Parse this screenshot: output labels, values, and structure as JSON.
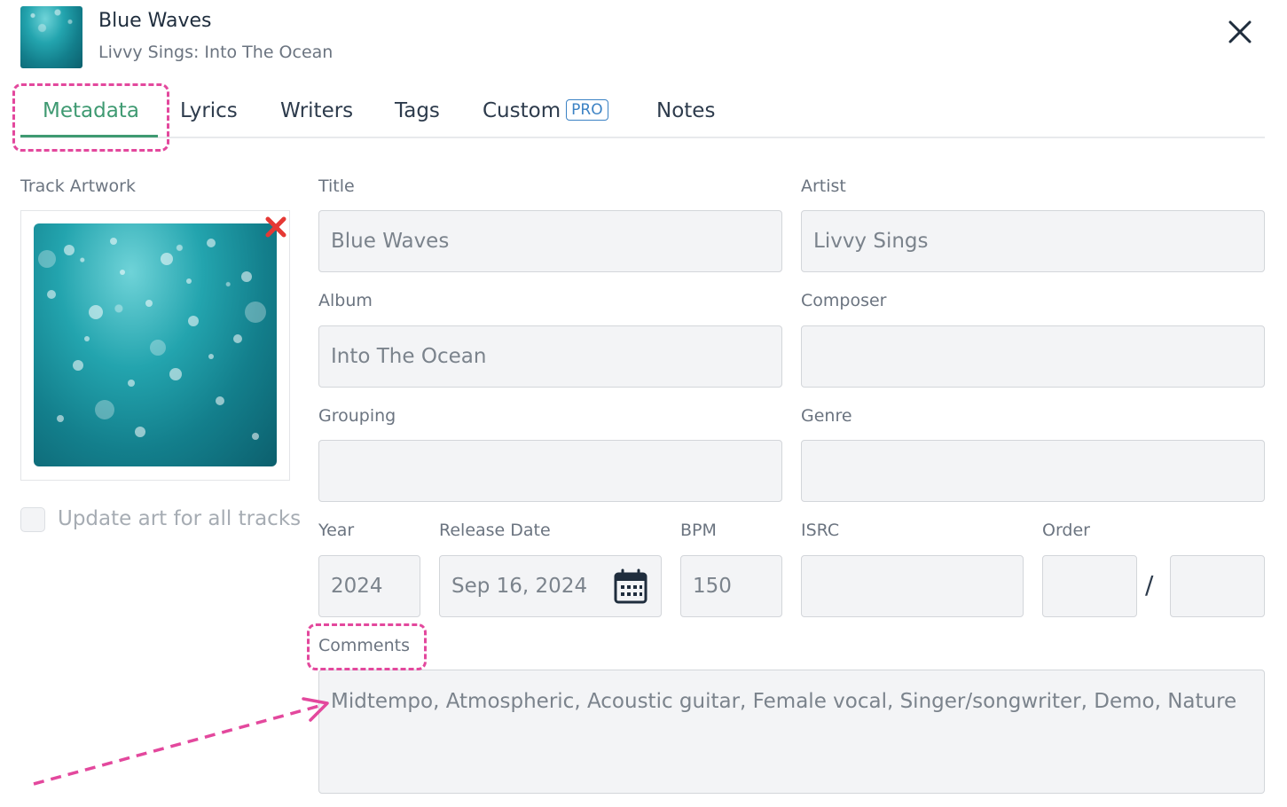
{
  "header": {
    "title": "Blue Waves",
    "subtitle": "Livvy Sings: Into The Ocean"
  },
  "tabs": [
    {
      "label": "Metadata",
      "active": true
    },
    {
      "label": "Lyrics"
    },
    {
      "label": "Writers"
    },
    {
      "label": "Tags"
    },
    {
      "label": "Custom",
      "badge": "PRO"
    },
    {
      "label": "Notes"
    }
  ],
  "artwork": {
    "label": "Track Artwork",
    "update_all_label": "Update art for all tracks",
    "update_all_checked": false
  },
  "fields": {
    "title": {
      "label": "Title",
      "value": "Blue Waves"
    },
    "artist": {
      "label": "Artist",
      "value": "Livvy Sings"
    },
    "album": {
      "label": "Album",
      "value": "Into The Ocean"
    },
    "composer": {
      "label": "Composer",
      "value": ""
    },
    "grouping": {
      "label": "Grouping",
      "value": ""
    },
    "genre": {
      "label": "Genre",
      "value": ""
    },
    "year": {
      "label": "Year",
      "value": "2024"
    },
    "release_date": {
      "label": "Release Date",
      "value": "Sep 16, 2024"
    },
    "bpm": {
      "label": "BPM",
      "value": "150"
    },
    "isrc": {
      "label": "ISRC",
      "value": ""
    },
    "order": {
      "label": "Order",
      "value": "",
      "total": "",
      "separator": "/"
    },
    "comments": {
      "label": "Comments",
      "value": "Midtempo, Atmospheric, Acoustic guitar, Female vocal, Singer/songwriter, Demo, Nature"
    }
  },
  "colors": {
    "accent": "#3f9a72",
    "annotation": "#e3489d",
    "pro_badge": "#3b82c4",
    "remove_icon": "#e53935"
  }
}
